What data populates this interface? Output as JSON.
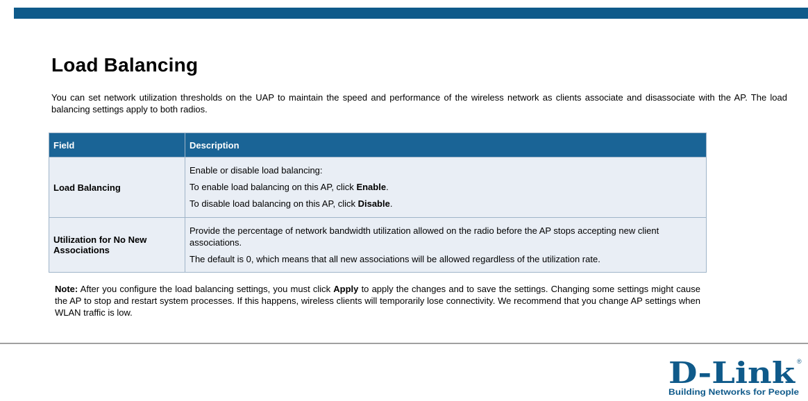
{
  "page": {
    "title": "Load Balancing",
    "intro": "You can set network utilization thresholds on the UAP to maintain the speed and performance of the wireless network as clients associate and disassociate with the AP. The load balancing settings apply to both radios."
  },
  "table": {
    "headers": [
      "Field",
      "Description"
    ],
    "rows": [
      {
        "field": "Load Balancing",
        "lines": [
          {
            "text": "Enable or disable load balancing:",
            "bold": ""
          },
          {
            "text": "To enable load balancing on this AP, click ",
            "bold": "Enable",
            "end": "."
          },
          {
            "text": "To disable load balancing on this AP, click ",
            "bold": "Disable",
            "end": "."
          }
        ]
      },
      {
        "field": "Utilization for No New Associations",
        "lines": [
          {
            "text": "Provide the percentage of network bandwidth utilization allowed on the radio before the AP stops accepting new client associations.",
            "bold": ""
          },
          {
            "text": "The default is 0, which means that all new associations will be allowed regardless of the utilization rate.",
            "bold": ""
          }
        ]
      }
    ]
  },
  "note": {
    "label": "Note:",
    "before": " After you configure the load balancing settings, you must click ",
    "bold": "Apply",
    "after": " to apply the changes and to save the settings. Changing some settings might cause the AP to stop and restart system processes. If this happens, wireless clients will temporarily lose connectivity. We recommend that you change AP settings when WLAN traffic is low."
  },
  "logo": {
    "brand": "D-Link",
    "tagline": "Building Networks for People",
    "registered": "®",
    "color": "#0f5a8a"
  },
  "colors": {
    "header_bar": "#0f5a8a",
    "table_header": "#1a6496",
    "table_cell": "#e9eef5"
  }
}
